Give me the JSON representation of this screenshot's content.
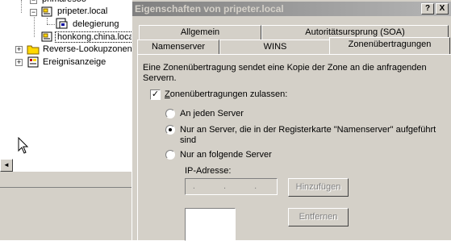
{
  "tree": {
    "items": [
      {
        "label": "primaresoo",
        "selected": false
      },
      {
        "label": "pripeter.local",
        "selected": false
      },
      {
        "label": "delegierung",
        "selected": false
      },
      {
        "label": "honkong.china.local",
        "selected": true
      },
      {
        "label": "Reverse-Lookupzonen",
        "selected": false
      },
      {
        "label": "Ereignisanzeige",
        "selected": false
      }
    ],
    "expander_expanded": "−",
    "expander_collapsed": "+",
    "scroll_left_arrow": "◄"
  },
  "dialog": {
    "title": "Eigenschaften von pripeter.local",
    "help_button": "?",
    "close_button": "X",
    "tabs_back": [
      "Allgemein",
      "Autoritätsursprung (SOA)"
    ],
    "tabs_front": [
      "Namenserver",
      "WINS",
      "Zonenübertragungen"
    ],
    "active_tab": "Zonenübertragungen",
    "description": [
      "Eine Zonenübertragung sendet eine Kopie der Zone an die anfragenden",
      "Servern."
    ],
    "allow_checkbox": {
      "label": "Zonenübertragungen zulassen:",
      "checked": true,
      "mark": "✓"
    },
    "radios": [
      {
        "label_lines": [
          "An jeden Server"
        ],
        "selected": false
      },
      {
        "label_lines": [
          "Nur an Server, die in der Registerkarte \"Namenserver\" aufgeführt",
          "sind"
        ],
        "selected": true
      },
      {
        "label_lines": [
          "Nur an folgende Server"
        ],
        "selected": false
      }
    ],
    "ip_label": "IP-Adresse:",
    "ip_value": ". . .",
    "add_button": "Hinzufügen",
    "remove_button": "Entfernen"
  }
}
